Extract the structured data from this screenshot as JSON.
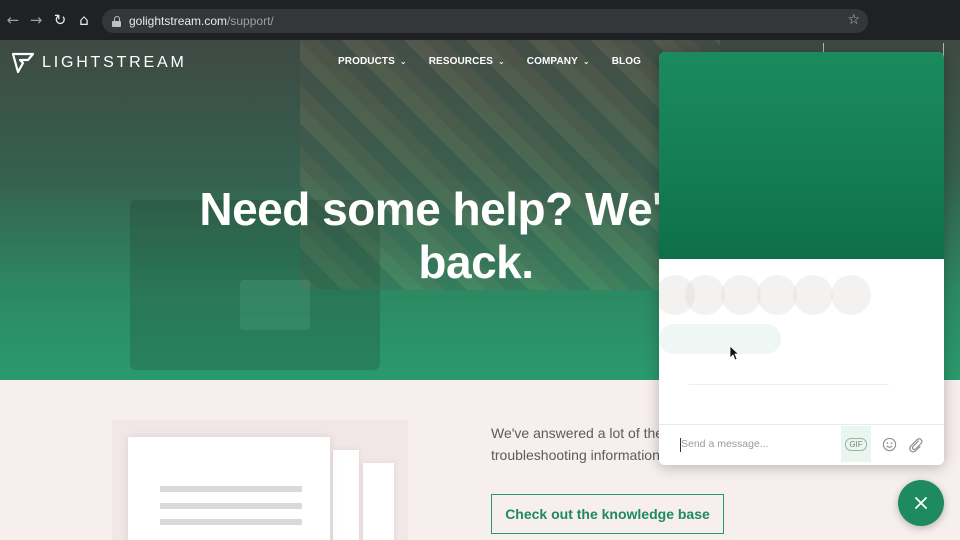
{
  "browser": {
    "url_domain": "golightstream.com",
    "url_path": "/support/",
    "back_icon": "back-arrow-icon",
    "forward_icon": "forward-arrow-icon",
    "reload_icon": "reload-icon",
    "home_icon": "home-icon",
    "bookmark_icon": "star-icon"
  },
  "site": {
    "logo_text": "LIGHTSTREAM",
    "nav": [
      {
        "label": "PRODUCTS",
        "has_dropdown": true
      },
      {
        "label": "RESOURCES",
        "has_dropdown": true
      },
      {
        "label": "COMPANY",
        "has_dropdown": true
      },
      {
        "label": "BLOG",
        "has_dropdown": false
      }
    ]
  },
  "hero": {
    "headline_line1": "Need some help? We've g",
    "headline_line2": "back."
  },
  "support": {
    "text_line1": "We've answered a lot of the m",
    "text_line2": "troubleshooting information",
    "kb_button_label": "Check out the knowledge base"
  },
  "chat": {
    "message_placeholder": "Send a message...",
    "gif_label": "GIF",
    "emoji_icon": "emoji-icon",
    "attach_icon": "paperclip-icon",
    "close_icon": "close-icon"
  },
  "colors": {
    "brand_green": "#1f8a5e",
    "browser_chrome": "#202124",
    "page_bg": "#f7eeee"
  }
}
